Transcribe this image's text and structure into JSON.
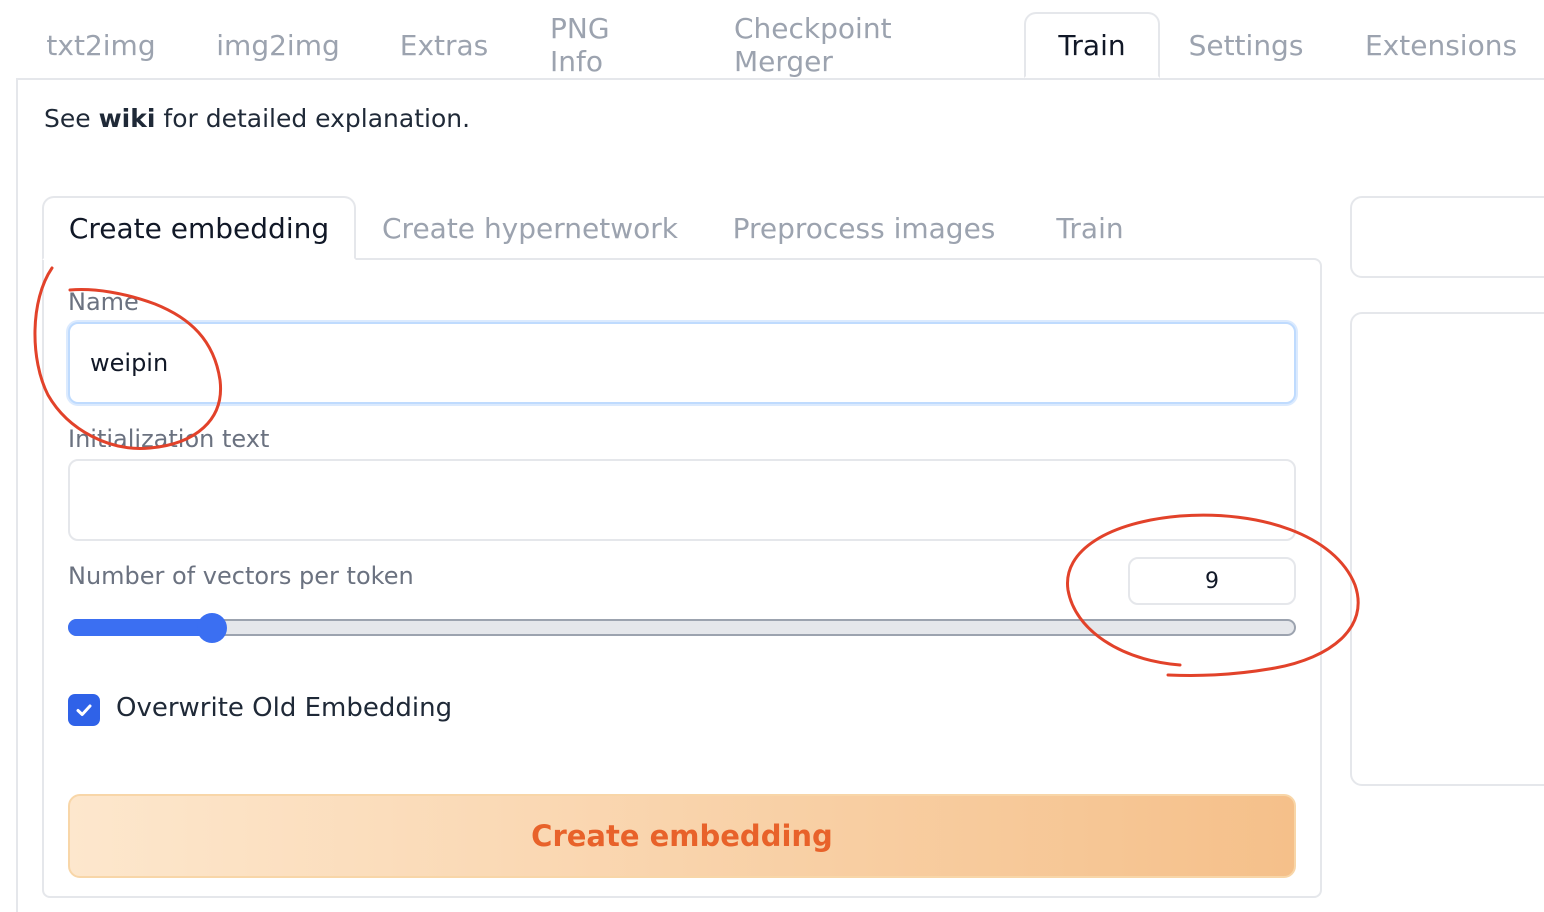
{
  "top_tabs": [
    {
      "label": "txt2img"
    },
    {
      "label": "img2img"
    },
    {
      "label": "Extras"
    },
    {
      "label": "PNG Info"
    },
    {
      "label": "Checkpoint Merger"
    },
    {
      "label": "Train"
    },
    {
      "label": "Settings"
    },
    {
      "label": "Extensions"
    }
  ],
  "active_top_tab": "Train",
  "wiki_note": {
    "prefix": "See ",
    "link": "wiki",
    "suffix": " for detailed explanation."
  },
  "sub_tabs": [
    {
      "label": "Create embedding"
    },
    {
      "label": "Create hypernetwork"
    },
    {
      "label": "Preprocess images"
    },
    {
      "label": "Train"
    }
  ],
  "active_sub_tab": "Create embedding",
  "form": {
    "name_label": "Name",
    "name_value": "weipin",
    "init_text_label": "Initialization text",
    "init_text_value": "",
    "vectors_label": "Number of vectors per token",
    "vectors_value": "9",
    "vectors_slider_fraction": 0.117,
    "overwrite_label": "Overwrite Old Embedding",
    "overwrite_checked": true,
    "create_button_label": "Create embedding"
  },
  "colors": {
    "accent_blue": "#3b6ff2",
    "button_text": "#e8622a",
    "annotation_red": "#e2422a"
  }
}
